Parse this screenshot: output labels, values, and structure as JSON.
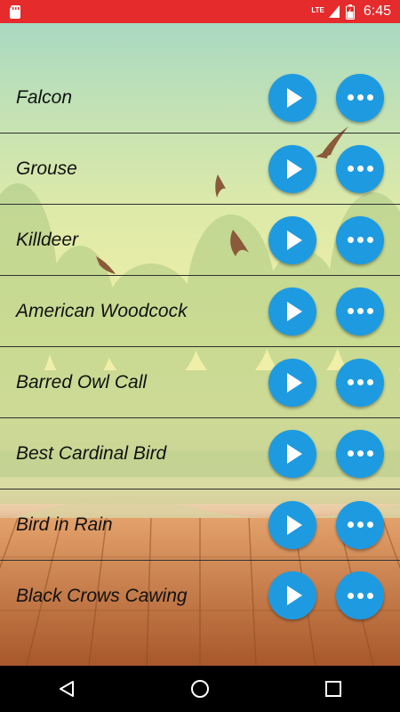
{
  "status_bar": {
    "network_label": "LTE",
    "time": "6:45",
    "icons": [
      "sd-card-icon",
      "signal-icon",
      "battery-icon"
    ]
  },
  "colors": {
    "status_bar": "#e52b2b",
    "button": "#1e9be0",
    "divider": "#2f2f2f"
  },
  "sounds": [
    {
      "label": "Falcon"
    },
    {
      "label": "Grouse"
    },
    {
      "label": "Killdeer"
    },
    {
      "label": "American Woodcock"
    },
    {
      "label": "Barred Owl Call"
    },
    {
      "label": "Best Cardinal Bird"
    },
    {
      "label": "Bird in Rain"
    },
    {
      "label": "Black Crows Cawing"
    }
  ],
  "nav_bar": {
    "icons": [
      "back-icon",
      "home-icon",
      "recents-icon"
    ]
  }
}
